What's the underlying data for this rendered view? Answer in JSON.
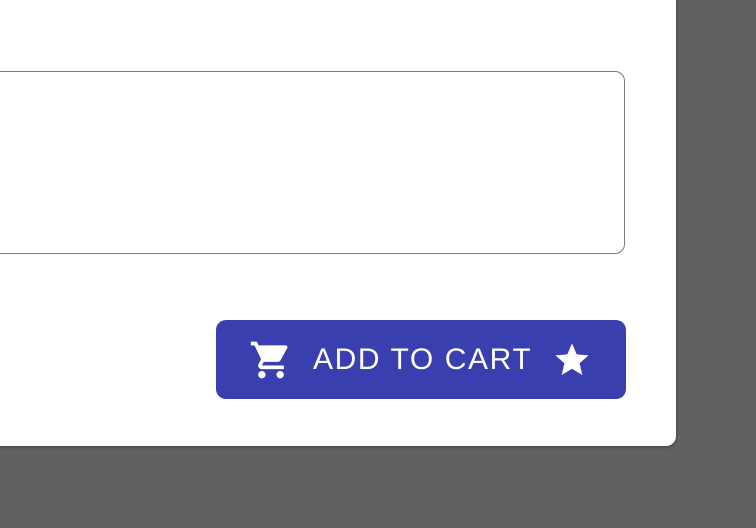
{
  "colors": {
    "backdrop": "#616161",
    "card": "#ffffff",
    "field_border": "#7a7a7a",
    "button": "#3a3fb0",
    "button_text": "#ffffff"
  },
  "form": {
    "text_area": {
      "value": "",
      "placeholder": ""
    }
  },
  "actions": {
    "add_to_cart": {
      "label": "ADD TO CART",
      "start_icon": "shopping-cart-icon",
      "end_icon": "star-icon"
    }
  }
}
